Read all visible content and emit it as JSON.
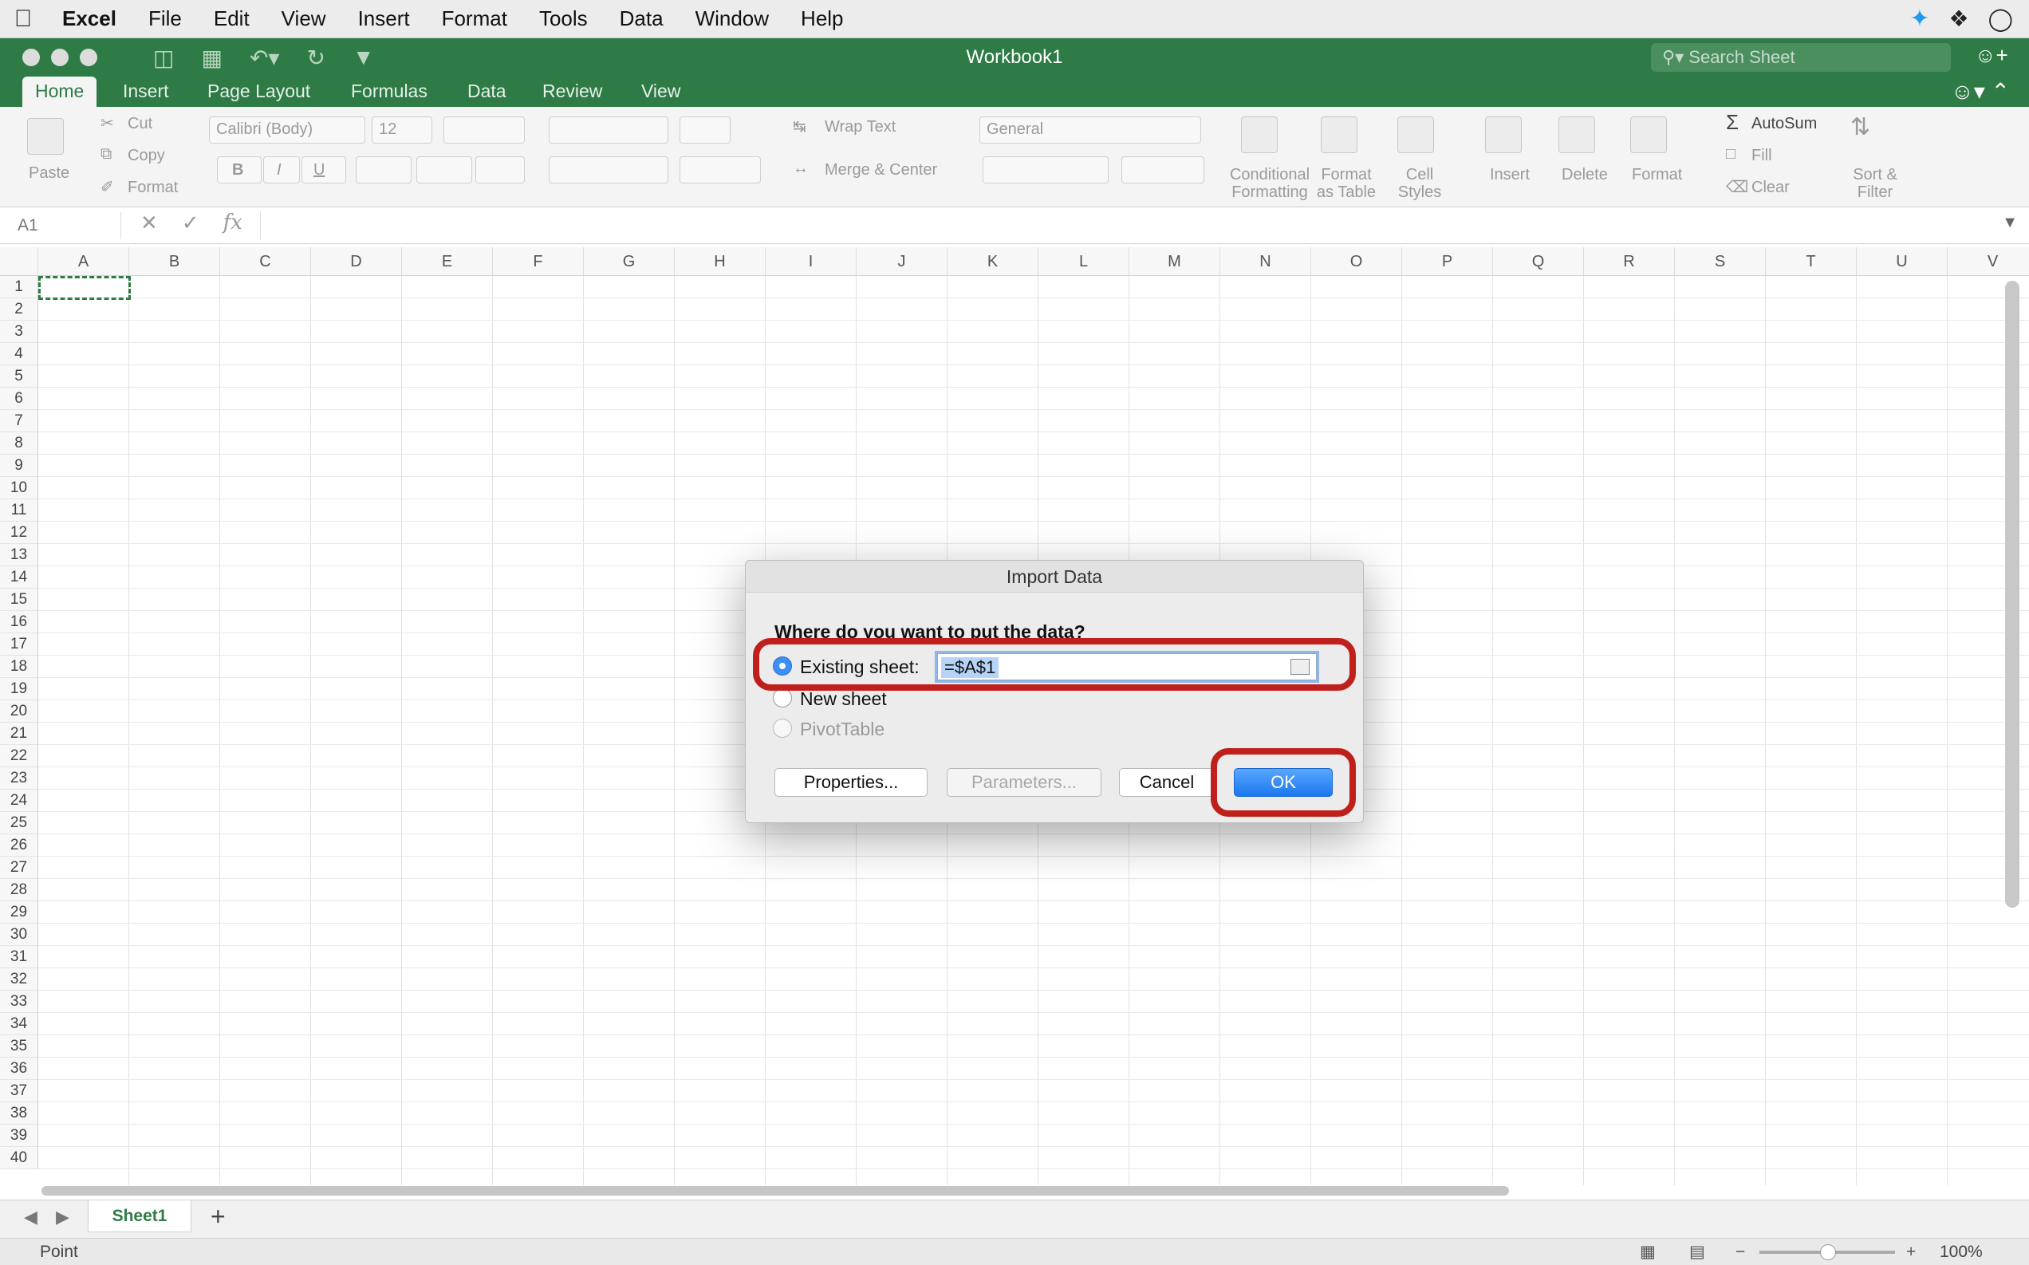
{
  "menubar": {
    "app": "Excel",
    "items": [
      "File",
      "Edit",
      "View",
      "Insert",
      "Format",
      "Tools",
      "Data",
      "Window",
      "Help"
    ],
    "icons": [
      "twitter-icon",
      "dropbox-icon",
      "sync-icon"
    ]
  },
  "window": {
    "title": "Workbook1",
    "search_placeholder": "Search Sheet"
  },
  "tabs": {
    "items": [
      "Home",
      "Insert",
      "Page Layout",
      "Formulas",
      "Data",
      "Review",
      "View"
    ],
    "active": "Home"
  },
  "ribbon": {
    "paste": "Paste",
    "cut": "Cut",
    "copy": "Copy",
    "format_painter": "Format",
    "font_name": "Calibri (Body)",
    "font_size": "12",
    "bold": "B",
    "italic": "I",
    "underline": "U",
    "wrap_text": "Wrap Text",
    "merge_center": "Merge & Center",
    "number_format": "General",
    "conditional_line1": "Conditional",
    "conditional_line2": "Formatting",
    "format_table_line1": "Format",
    "format_table_line2": "as Table",
    "cell_styles_line1": "Cell",
    "cell_styles_line2": "Styles",
    "insert": "Insert",
    "delete": "Delete",
    "format": "Format",
    "autosum": "AutoSum",
    "fill": "Fill",
    "clear": "Clear",
    "sort_line1": "Sort &",
    "sort_line2": "Filter"
  },
  "formula_bar": {
    "name_box": "A1",
    "fx": "fx",
    "value": ""
  },
  "grid": {
    "columns": [
      "A",
      "B",
      "C",
      "D",
      "E",
      "F",
      "G",
      "H",
      "I",
      "J",
      "K",
      "L",
      "M",
      "N",
      "O",
      "P",
      "Q",
      "R",
      "S",
      "T",
      "U",
      "V"
    ],
    "row_count": 41,
    "selected_cell": "A1"
  },
  "sheets": {
    "tabs": [
      "Sheet1"
    ],
    "add": "+"
  },
  "status": {
    "mode": "Point",
    "zoom": "100%"
  },
  "dialog": {
    "title": "Import Data",
    "question": "Where do you want to put the data?",
    "option_existing": "Existing sheet:",
    "existing_value": "=$A$1",
    "option_new": "New sheet",
    "option_pivot": "PivotTable",
    "btn_properties": "Properties...",
    "btn_parameters": "Parameters...",
    "btn_cancel": "Cancel",
    "btn_ok": "OK",
    "highlight_color": "#c0201c"
  }
}
